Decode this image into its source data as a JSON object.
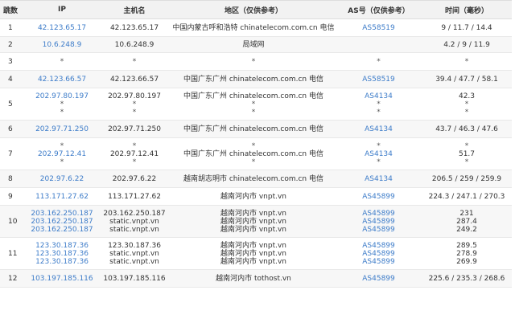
{
  "headers": [
    "跳数",
    "IP",
    "主机名",
    "地区（仅供参考）",
    "AS号（仅供参考）",
    "时间（毫秒）"
  ],
  "rows": [
    {
      "hop": "1",
      "ip": [
        "42.123.65.17"
      ],
      "host": [
        "42.123.65.17"
      ],
      "region": [
        "中国内蒙古呼和浩特 chinatelecom.com.cn 电信"
      ],
      "as": [
        "AS58519"
      ],
      "time": [
        "9 / 11.7 / 14.4"
      ]
    },
    {
      "hop": "2",
      "ip": [
        "10.6.248.9"
      ],
      "host": [
        "10.6.248.9"
      ],
      "region": [
        "局域网"
      ],
      "as": [
        ""
      ],
      "time": [
        "4.2 / 9 / 11.9"
      ]
    },
    {
      "hop": "3",
      "ip": [
        "*"
      ],
      "host": [
        "*"
      ],
      "region": [
        "*"
      ],
      "as": [
        "*"
      ],
      "time": [
        "*"
      ]
    },
    {
      "hop": "4",
      "ip": [
        "42.123.66.57"
      ],
      "host": [
        "42.123.66.57"
      ],
      "region": [
        "中国广东广州 chinatelecom.com.cn 电信"
      ],
      "as": [
        "AS58519"
      ],
      "time": [
        "39.4 / 47.7 / 58.1"
      ]
    },
    {
      "hop": "5",
      "ip": [
        "202.97.80.197",
        "*",
        "*"
      ],
      "host": [
        "202.97.80.197",
        "*",
        "*"
      ],
      "region": [
        "中国广东广州 chinatelecom.com.cn 电信",
        "*",
        "*"
      ],
      "as": [
        "AS4134",
        "*",
        "*"
      ],
      "time": [
        "42.3",
        "*",
        "*"
      ]
    },
    {
      "hop": "6",
      "ip": [
        "202.97.71.250"
      ],
      "host": [
        "202.97.71.250"
      ],
      "region": [
        "中国广东广州 chinatelecom.com.cn 电信"
      ],
      "as": [
        "AS4134"
      ],
      "time": [
        "43.7 / 46.3 / 47.6"
      ]
    },
    {
      "hop": "7",
      "ip": [
        "*",
        "202.97.12.41",
        "*"
      ],
      "host": [
        "*",
        "202.97.12.41",
        "*"
      ],
      "region": [
        "*",
        "中国广东广州 chinatelecom.com.cn 电信",
        "*"
      ],
      "as": [
        "*",
        "AS4134",
        "*"
      ],
      "time": [
        "*",
        "51.7",
        "*"
      ]
    },
    {
      "hop": "8",
      "ip": [
        "202.97.6.22"
      ],
      "host": [
        "202.97.6.22"
      ],
      "region": [
        "越南胡志明市 chinatelecom.com.cn 电信"
      ],
      "as": [
        "AS4134"
      ],
      "time": [
        "206.5 / 259 / 259.9"
      ]
    },
    {
      "hop": "9",
      "ip": [
        "113.171.27.62"
      ],
      "host": [
        "113.171.27.62"
      ],
      "region": [
        "越南河内市 vnpt.vn"
      ],
      "as": [
        "AS45899"
      ],
      "time": [
        "224.3 / 247.1 / 270.3"
      ]
    },
    {
      "hop": "10",
      "ip": [
        "203.162.250.187",
        "203.162.250.187",
        "203.162.250.187"
      ],
      "host": [
        "203.162.250.187",
        "static.vnpt.vn",
        "static.vnpt.vn"
      ],
      "region": [
        "越南河内市 vnpt.vn",
        "越南河内市 vnpt.vn",
        "越南河内市 vnpt.vn"
      ],
      "as": [
        "AS45899",
        "AS45899",
        "AS45899"
      ],
      "time": [
        "231",
        "287.4",
        "249.2"
      ]
    },
    {
      "hop": "11",
      "ip": [
        "123.30.187.36",
        "123.30.187.36",
        "123.30.187.36"
      ],
      "host": [
        "123.30.187.36",
        "static.vnpt.vn",
        "static.vnpt.vn"
      ],
      "region": [
        "越南河内市 vnpt.vn",
        "越南河内市 vnpt.vn",
        "越南河内市 vnpt.vn"
      ],
      "as": [
        "AS45899",
        "AS45899",
        "AS45899"
      ],
      "time": [
        "289.5",
        "278.9",
        "269.9"
      ]
    },
    {
      "hop": "12",
      "ip": [
        "103.197.185.116"
      ],
      "host": [
        "103.197.185.116"
      ],
      "region": [
        "越南河内市 tothost.vn"
      ],
      "as": [
        "AS45899"
      ],
      "time": [
        "225.6 / 235.3 / 268.6"
      ]
    }
  ]
}
